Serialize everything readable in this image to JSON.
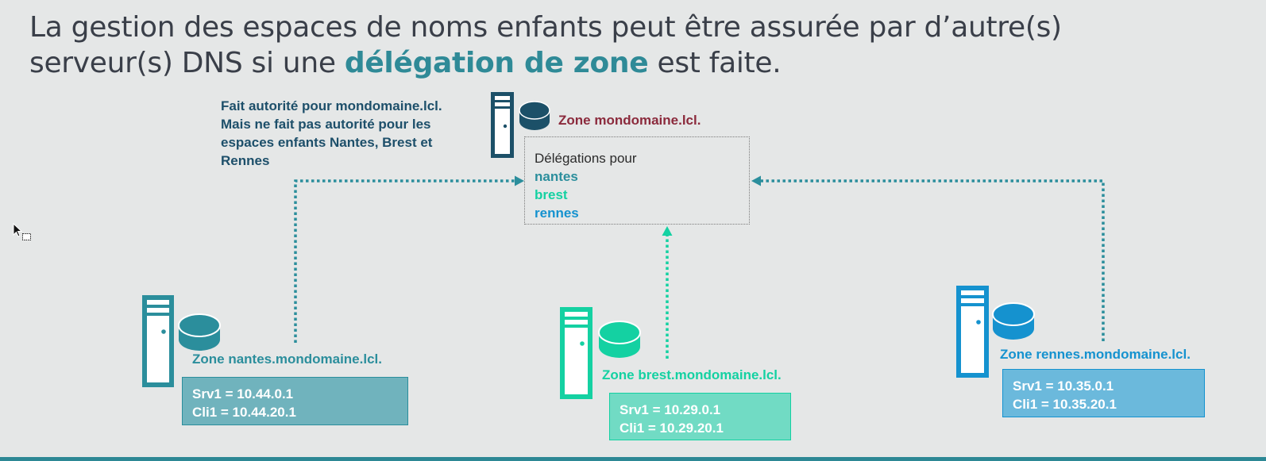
{
  "title": {
    "line1": "La gestion des espaces de noms enfants peut être assurée par d’autre(s)",
    "line2_before": "serveur(s) DNS si une ",
    "line2_highlight": "délégation de zone",
    "line2_after": " est faite."
  },
  "note": {
    "line1": "Fait autorité pour mondomaine.lcl.",
    "line2": "Mais ne fait pas autorité pour les",
    "line3": "espaces enfants Nantes, Brest et",
    "line4": "Rennes"
  },
  "parent": {
    "zone_label": "Zone mondomaine.lcl.",
    "delegations_intro": "Délégations pour",
    "delegations": [
      "nantes",
      "brest",
      "rennes"
    ]
  },
  "children": [
    {
      "name": "nantes",
      "zone_label": "Zone nantes.mondomaine.lcl.",
      "srv": "Srv1 = 10.44.0.1",
      "cli": "Cli1 = 10.44.20.1"
    },
    {
      "name": "brest",
      "zone_label": "Zone brest.mondomaine.lcl.",
      "srv": "Srv1 = 10.29.0.1",
      "cli": "Cli1 = 10.29.20.1"
    },
    {
      "name": "rennes",
      "zone_label": "Zone rennes.mondomaine.lcl.",
      "srv": "Srv1 = 10.35.0.1",
      "cli": "Cli1 = 10.35.20.1"
    }
  ],
  "colors": {
    "title_highlight": "#2f8a97",
    "note_text": "#1d4f6a",
    "parent_server": "#1c5068",
    "parent_zone_label": "#8b2a3c",
    "nantes": "#2b8e9c",
    "nantes_box": "#70b3bd",
    "brest": "#14d1a2",
    "brest_box": "#71dbc4",
    "rennes": "#1592cf",
    "rennes_box": "#6bb9dc",
    "background": "#e5e7e7"
  },
  "icons": [
    "server-tower-icon",
    "database-disk-icon",
    "mouse-cursor-icon"
  ]
}
